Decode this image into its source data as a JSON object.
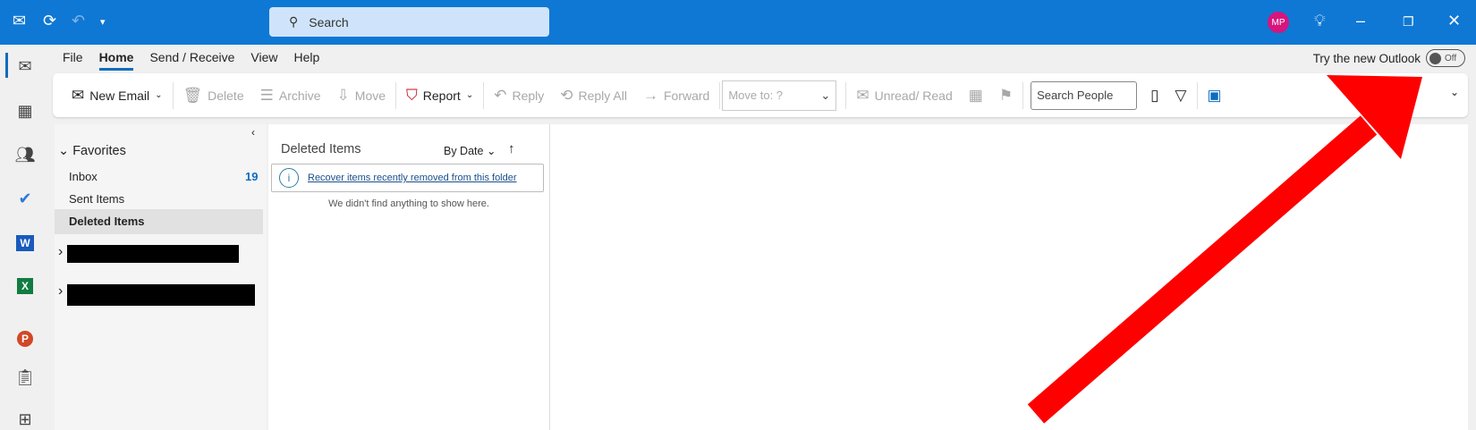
{
  "titlebar": {
    "search_placeholder": "Search",
    "avatar_initials": "MP"
  },
  "menu": {
    "tabs": [
      "File",
      "Home",
      "Send / Receive",
      "View",
      "Help"
    ],
    "active": "Home"
  },
  "try_new": {
    "label": "Try the new Outlook",
    "toggle": "Off"
  },
  "ribbon": {
    "new_email": "New Email",
    "delete": "Delete",
    "archive": "Archive",
    "move": "Move",
    "report": "Report",
    "reply": "Reply",
    "reply_all": "Reply All",
    "forward": "Forward",
    "move_to": "Move to: ?",
    "unread_read": "Unread/ Read",
    "search_people": "Search People"
  },
  "folders": {
    "favorites": "Favorites",
    "items": [
      {
        "label": "Inbox",
        "count": "19"
      },
      {
        "label": "Sent Items",
        "count": ""
      },
      {
        "label": "Deleted Items",
        "count": ""
      }
    ]
  },
  "list": {
    "title": "Deleted Items",
    "sort": "By Date",
    "recover_link": "Recover items recently removed from this folder",
    "empty": "We didn't find anything to show here."
  },
  "colors": {
    "brand": "#0f78d4",
    "arrow": "#ff0000"
  }
}
